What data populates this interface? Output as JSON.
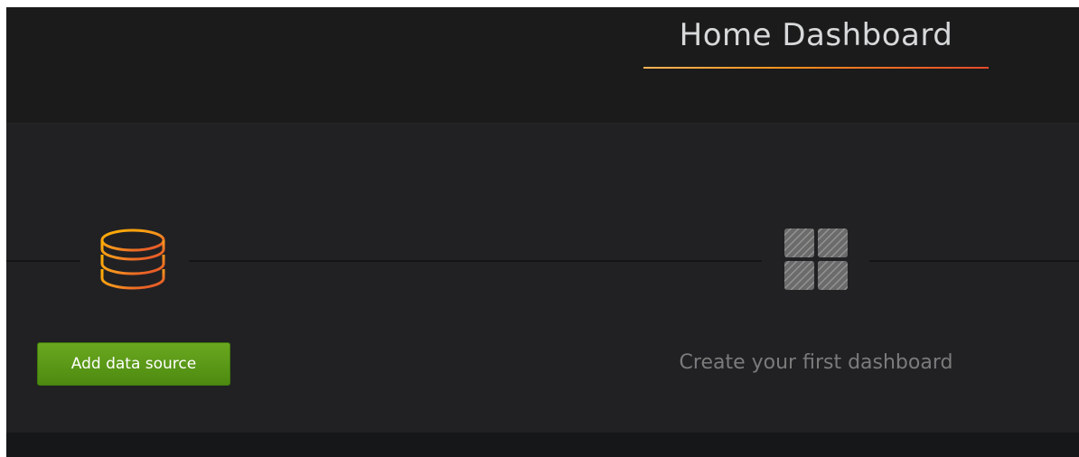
{
  "header": {
    "title": "Home Dashboard"
  },
  "getting_started": {
    "steps": [
      {
        "icon": "database-icon",
        "button_label": "Add data source",
        "state": "active"
      },
      {
        "icon": "dashboard-grid-icon",
        "label": "Create your first dashboard",
        "state": "pending"
      }
    ]
  },
  "colors": {
    "background": "#161719",
    "panel": "#212124",
    "accent_orange": "#f7931e",
    "accent_red": "#e44a2a",
    "button_green": "#5e9b1a",
    "muted_text": "#7b7b7b"
  }
}
